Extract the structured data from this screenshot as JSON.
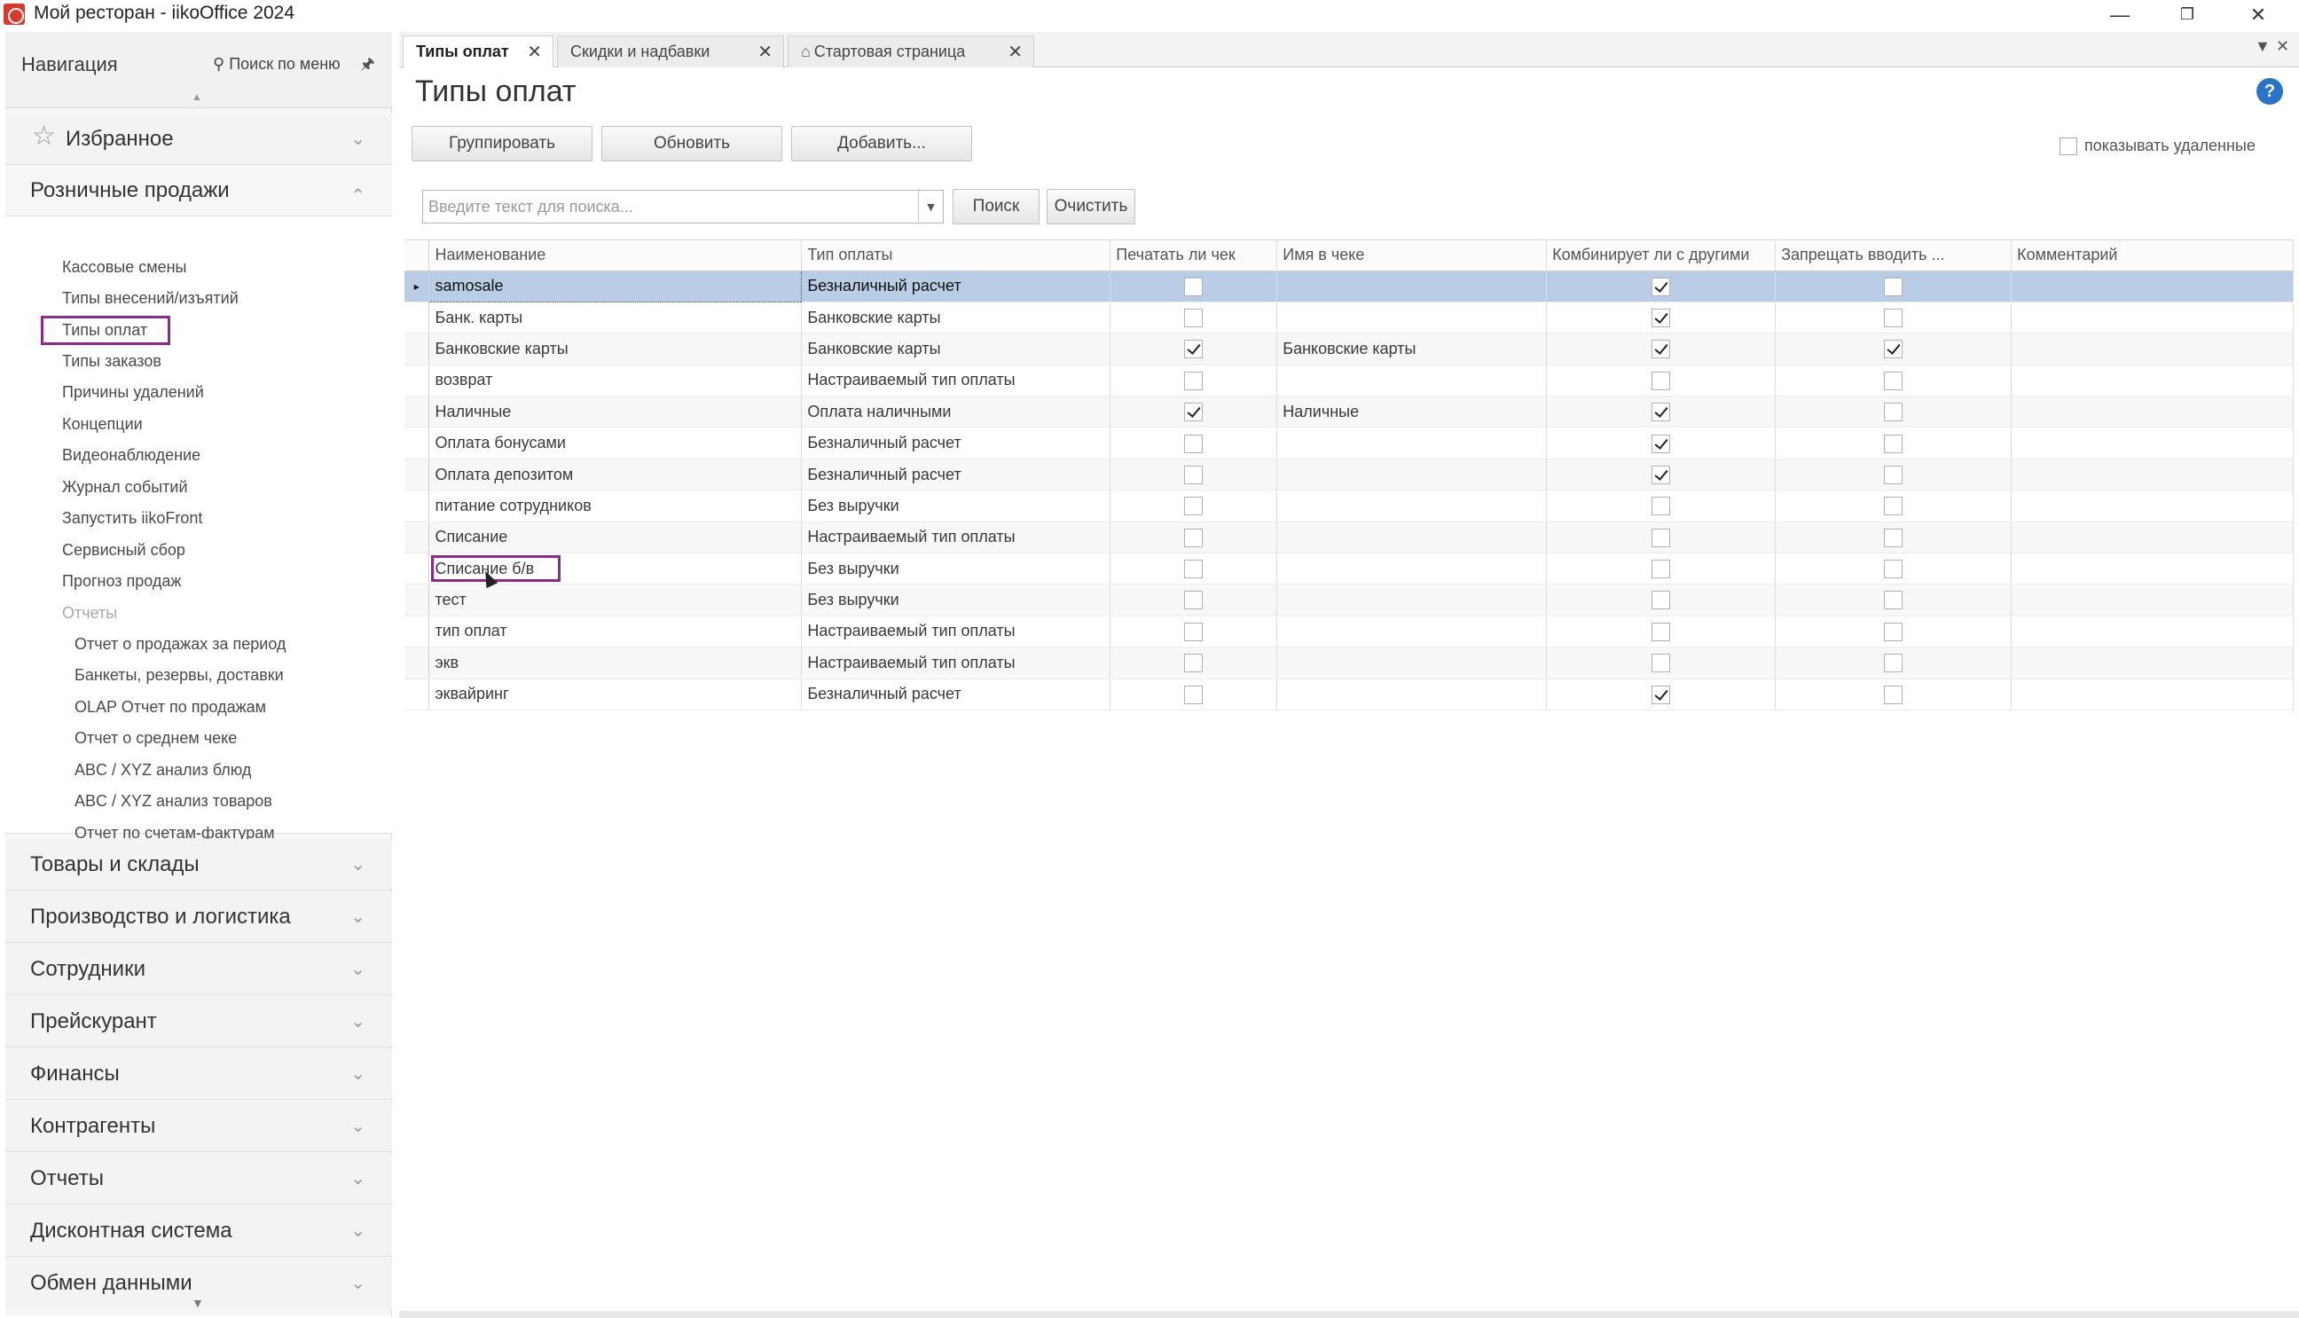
{
  "window": {
    "title": "Мой ресторан - iikoOffice 2024"
  },
  "navigation": {
    "title": "Навигация",
    "search_label": "Поиск по меню",
    "favorites_label": "Избранное",
    "retail": {
      "label": "Розничные продажи",
      "items": [
        "Кассовые смены",
        "Типы внесений/изъятий",
        "Типы оплат",
        "Типы заказов",
        "Причины удалений",
        "Концепции",
        "Видеонаблюдение",
        "Журнал событий",
        "Запустить iikoFront",
        "Сервисный сбор",
        "Прогноз продаж"
      ],
      "reports_label": "Отчеты",
      "reports": [
        "Отчет о продажах за период",
        "Банкеты, резервы, доставки",
        "OLAP Отчет по продажам",
        "Отчет о среднем чеке",
        "ABC / XYZ анализ блюд",
        "ABC / XYZ анализ товаров",
        "Отчет по счетам-фактурам"
      ]
    },
    "sections": [
      "Товары и склады",
      "Производство и логистика",
      "Сотрудники",
      "Прейскурант",
      "Финансы",
      "Контрагенты",
      "Отчеты",
      "Дисконтная система",
      "Обмен данными"
    ]
  },
  "tabs": [
    {
      "label": "Типы оплат",
      "active": true
    },
    {
      "label": "Скидки и надбавки",
      "active": false
    },
    {
      "label": "Стартовая страница",
      "active": false
    }
  ],
  "page": {
    "title": "Типы оплат",
    "toolbar": {
      "group_label": "Группировать",
      "refresh_label": "Обновить",
      "add_label": "Добавить...",
      "show_deleted_label": "показывать удаленные"
    },
    "search": {
      "placeholder": "Введите текст для поиска...",
      "search_label": "Поиск",
      "clear_label": "Очистить"
    }
  },
  "grid": {
    "columns": [
      "Наименование",
      "Тип оплаты",
      "Печатать ли чек",
      "Имя в чеке",
      "Комбинирует ли с другими",
      "Запрещать вводить ...",
      "Комментарий"
    ],
    "rows": [
      {
        "name": "samosale",
        "type": "Безналичный расчет",
        "print": false,
        "receipt_name": "",
        "combine": true,
        "forbid": false,
        "comment": ""
      },
      {
        "name": "Банк. карты",
        "type": "Банковские карты",
        "print": false,
        "receipt_name": "",
        "combine": true,
        "forbid": false,
        "comment": ""
      },
      {
        "name": "Банковские карты",
        "type": "Банковские карты",
        "print": true,
        "receipt_name": "Банковские карты",
        "combine": true,
        "forbid": true,
        "comment": ""
      },
      {
        "name": "возврат",
        "type": "Настраиваемый тип оплаты",
        "print": false,
        "receipt_name": "",
        "combine": false,
        "forbid": false,
        "comment": ""
      },
      {
        "name": "Наличные",
        "type": "Оплата наличными",
        "print": true,
        "receipt_name": "Наличные",
        "combine": true,
        "forbid": false,
        "comment": ""
      },
      {
        "name": "Оплата бонусами",
        "type": "Безналичный расчет",
        "print": false,
        "receipt_name": "",
        "combine": true,
        "forbid": false,
        "comment": ""
      },
      {
        "name": "Оплата депозитом",
        "type": "Безналичный расчет",
        "print": false,
        "receipt_name": "",
        "combine": true,
        "forbid": false,
        "comment": ""
      },
      {
        "name": "питание сотрудников",
        "type": "Без выручки",
        "print": false,
        "receipt_name": "",
        "combine": false,
        "forbid": false,
        "comment": ""
      },
      {
        "name": "Списание",
        "type": "Настраиваемый тип оплаты",
        "print": false,
        "receipt_name": "",
        "combine": false,
        "forbid": false,
        "comment": ""
      },
      {
        "name": "Списание б/в",
        "type": "Без выручки",
        "print": false,
        "receipt_name": "",
        "combine": false,
        "forbid": false,
        "comment": ""
      },
      {
        "name": "тест",
        "type": "Без выручки",
        "print": false,
        "receipt_name": "",
        "combine": false,
        "forbid": false,
        "comment": ""
      },
      {
        "name": "тип оплат",
        "type": "Настраиваемый тип оплаты",
        "print": false,
        "receipt_name": "",
        "combine": false,
        "forbid": false,
        "comment": ""
      },
      {
        "name": "экв",
        "type": "Настраиваемый тип оплаты",
        "print": false,
        "receipt_name": "",
        "combine": false,
        "forbid": false,
        "comment": ""
      },
      {
        "name": "эквайринг",
        "type": "Безналичный расчет",
        "print": false,
        "receipt_name": "",
        "combine": true,
        "forbid": false,
        "comment": ""
      }
    ]
  }
}
